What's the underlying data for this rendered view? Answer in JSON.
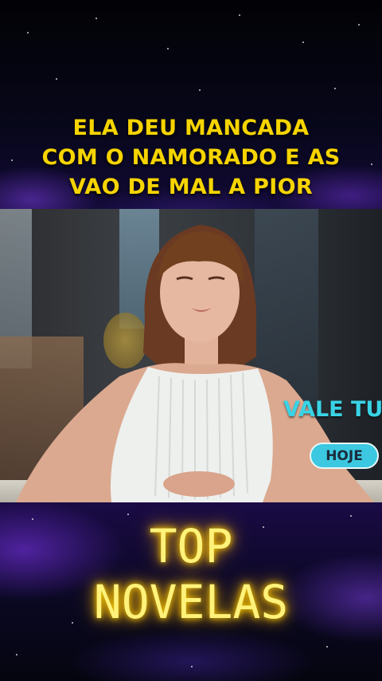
{
  "headline": {
    "lines": [
      "ELA DEU MANCADA",
      "COM O NAMORADO E AS",
      "VAO DE MAL A PIOR"
    ],
    "color": "#f6d400"
  },
  "video_overlay": {
    "promo_text": "VALE TUI",
    "button_label": "HOJE",
    "accent_color": "#39d3e6"
  },
  "brand": {
    "line1": "TOP",
    "line2": "NOVELAS",
    "glow_color": "#ffd400"
  }
}
